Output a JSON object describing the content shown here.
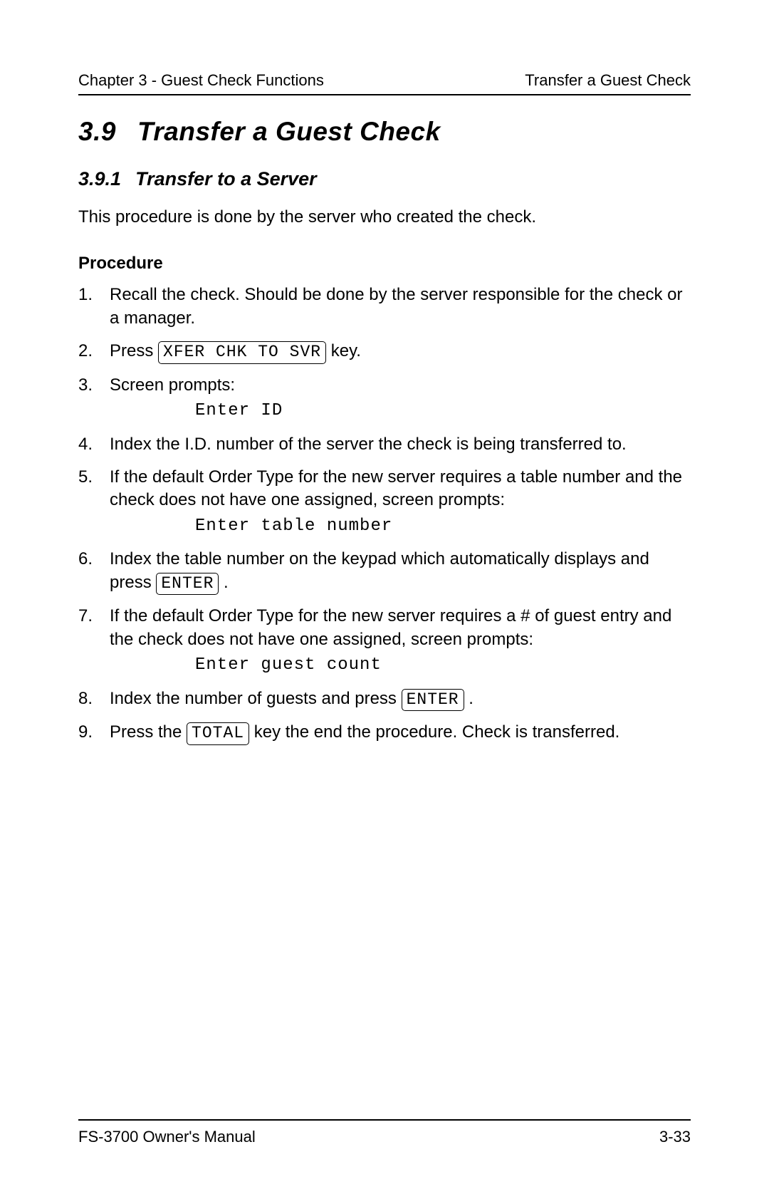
{
  "header": {
    "left": "Chapter 3 - Guest Check Functions",
    "right": "Transfer a Guest Check"
  },
  "section": {
    "number": "3.9",
    "title": "Transfer a Guest Check"
  },
  "subsection": {
    "number": "3.9.1",
    "title": "Transfer to a Server"
  },
  "intro": "This procedure is done by the server who created the check.",
  "procedure_label": "Procedure",
  "steps": {
    "s1": "Recall the check.  Should be done by the server responsible for the check or a manager.",
    "s2_a": "Press ",
    "s2_key": "XFER CHK TO SVR",
    "s2_b": " key.",
    "s3": "Screen prompts:",
    "s3_prompt": "Enter ID",
    "s4": "Index the I.D. number of the server the check is being transferred to.",
    "s5": "If the default Order Type for the new server requires a table number and the check does not have one assigned, screen prompts:",
    "s5_prompt": "Enter table number",
    "s6_a": "Index the table number on the keypad which automatically displays and press ",
    "s6_key": "ENTER",
    "s6_b": " .",
    "s7": "If the default Order Type for the new server requires a # of guest entry and the check does not have one assigned, screen prompts:",
    "s7_prompt": "Enter guest count",
    "s8_a": "Index the number of guests and press ",
    "s8_key": "ENTER",
    "s8_b": " .",
    "s9_a": "Press the ",
    "s9_key": "TOTAL",
    "s9_b": " key the end the procedure.  Check is transferred."
  },
  "footer": {
    "left": "FS-3700 Owner's Manual",
    "right": "3-33"
  }
}
